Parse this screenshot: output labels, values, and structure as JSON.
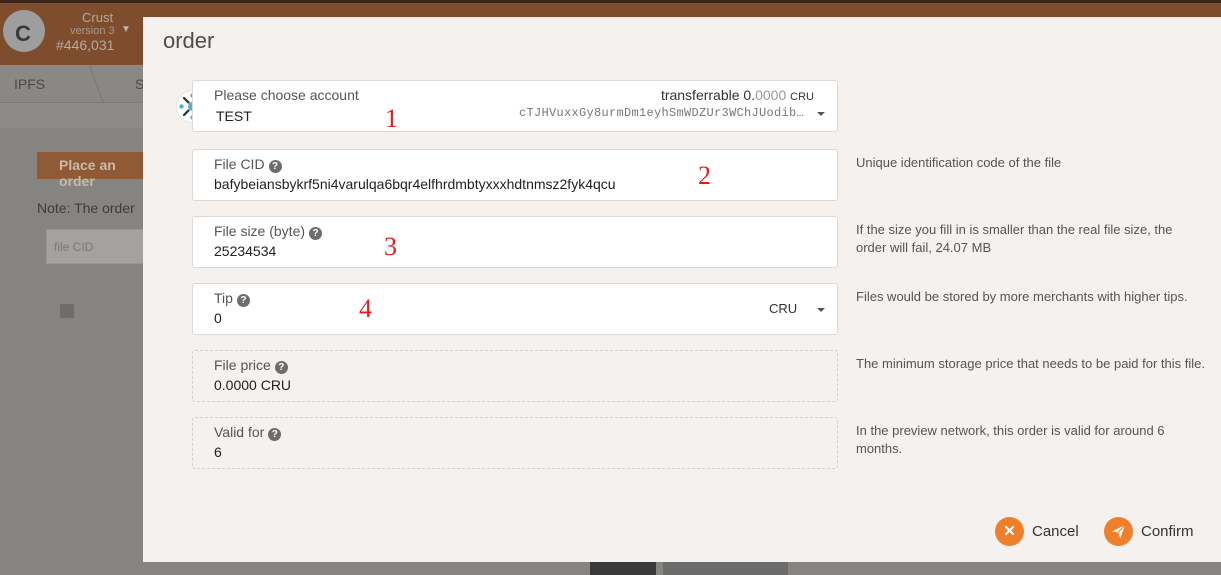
{
  "app": {
    "chain_name": "Crust",
    "chain_version": "version 3",
    "block_number": "#446,031",
    "logo_letter": "C",
    "tabs": [
      "IPFS",
      "S"
    ]
  },
  "background": {
    "place_order_button": "Place an order",
    "note_text": "Note: The order",
    "file_cid_placeholder": "file CID"
  },
  "modal": {
    "title": "order",
    "account": {
      "label": "Please choose account",
      "name": "TEST",
      "transferrable_label": "transferrable",
      "balance_int": "0.",
      "balance_frac": "0000",
      "balance_unit": "CRU",
      "address": "cTJHVuxxGy8urmDm1eyhSmWDZUr3WChJUodib…"
    },
    "file_cid": {
      "label": "File CID",
      "value": "bafybeiansbykrf5ni4varulqa6bqr4elfhrdmbtyxxxhdtnmsz2fyk4qcu",
      "hint": "Unique identification code of the file"
    },
    "file_size": {
      "label": "File size (byte)",
      "value": "25234534",
      "hint": "If the size you fill in is smaller than the real file size, the order will fail, 24.07 MB"
    },
    "tip": {
      "label": "Tip",
      "value": "0",
      "unit": "CRU",
      "hint": "Files would be stored by more merchants with higher tips."
    },
    "file_price": {
      "label": "File price",
      "value": "0.0000 CRU",
      "hint": "The minimum storage price that needs to be paid for this file."
    },
    "valid_for": {
      "label": "Valid for",
      "value": "6",
      "hint": "In the preview network, this order is valid for around 6 months."
    },
    "cancel_label": "Cancel",
    "confirm_label": "Confirm"
  },
  "annotations": {
    "mark1": "1",
    "mark2": "2",
    "mark3": "3",
    "mark4": "4"
  },
  "colors": {
    "accent": "#f07f2c",
    "annotation": "#e02020",
    "modal_bg": "#f4f1ee"
  }
}
